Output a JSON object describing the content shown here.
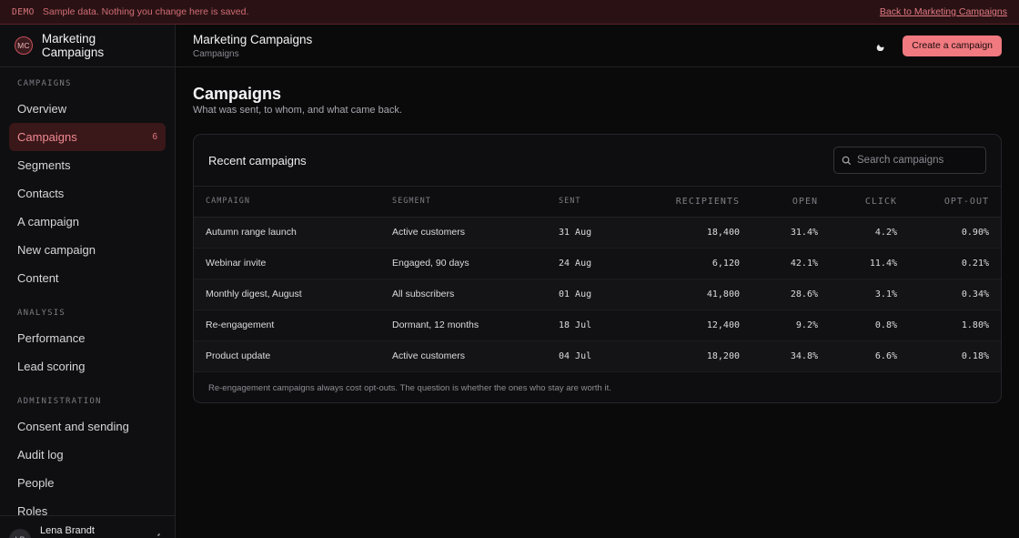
{
  "banner": {
    "tag": "DEMO",
    "message": "Sample data. Nothing you change here is saved.",
    "back_link": "Back to Marketing Campaigns"
  },
  "brand": {
    "initials": "MC",
    "name": "Marketing Campaigns"
  },
  "sidebar": {
    "sections": [
      {
        "label": "CAMPAIGNS",
        "items": [
          {
            "label": "Overview"
          },
          {
            "label": "Campaigns",
            "count": "6",
            "active": true
          },
          {
            "label": "Segments"
          },
          {
            "label": "Contacts"
          },
          {
            "label": "A campaign"
          },
          {
            "label": "New campaign"
          },
          {
            "label": "Content"
          }
        ]
      },
      {
        "label": "ANALYSIS",
        "items": [
          {
            "label": "Performance"
          },
          {
            "label": "Lead scoring"
          }
        ]
      },
      {
        "label": "ADMINISTRATION",
        "items": [
          {
            "label": "Consent and sending"
          },
          {
            "label": "Audit log"
          },
          {
            "label": "People"
          },
          {
            "label": "Roles"
          }
        ]
      }
    ],
    "user": {
      "initials": "LB",
      "name": "Lena Brandt"
    }
  },
  "topbar": {
    "title": "Marketing Campaigns",
    "breadcrumb": "Campaigns",
    "theme_icon": "moon-icon",
    "create_label": "Create a campaign"
  },
  "main": {
    "title": "Campaigns",
    "subtitle": "What was sent, to whom, and what came back.",
    "card": {
      "title": "Recent campaigns",
      "search_placeholder": "Search campaigns",
      "columns": [
        "CAMPAIGN",
        "SEGMENT",
        "SENT",
        "RECIPIENTS",
        "OPEN",
        "CLICK",
        "OPT-OUT"
      ],
      "rows": [
        [
          "Autumn range launch",
          "Active customers",
          "31 Aug",
          "18,400",
          "31.4%",
          "4.2%",
          "0.90%"
        ],
        [
          "Webinar invite",
          "Engaged, 90 days",
          "24 Aug",
          "6,120",
          "42.1%",
          "11.4%",
          "0.21%"
        ],
        [
          "Monthly digest, August",
          "All subscribers",
          "01 Aug",
          "41,800",
          "28.6%",
          "3.1%",
          "0.34%"
        ],
        [
          "Re-engagement",
          "Dormant, 12 months",
          "18 Jul",
          "12,400",
          "9.2%",
          "0.8%",
          "1.80%"
        ],
        [
          "Product update",
          "Active customers",
          "04 Jul",
          "18,200",
          "34.8%",
          "6.6%",
          "0.18%"
        ]
      ],
      "note": "Re-engagement campaigns always cost opt-outs. The question is whether the ones who stay are worth it."
    }
  },
  "colors": {
    "accent": "#f07a80",
    "banner_bg": "#2a1214",
    "active_nav_bg": "#3a1719"
  }
}
